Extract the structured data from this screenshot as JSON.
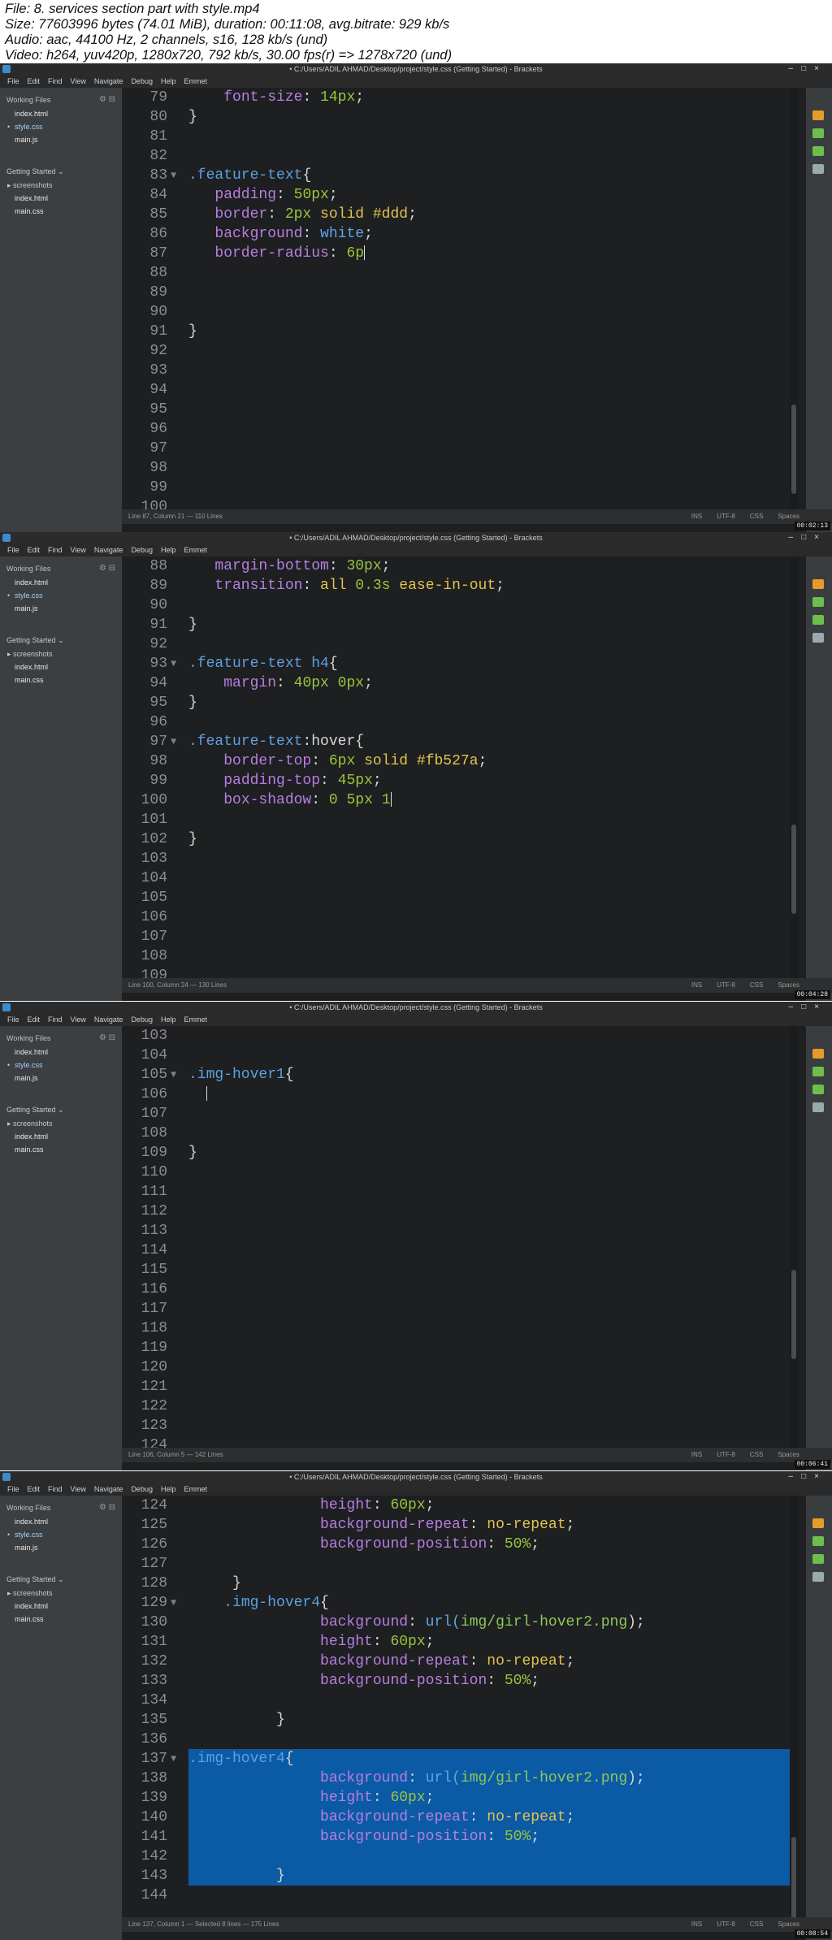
{
  "info": {
    "lines": [
      "File: 8. services section part with style.mp4",
      "Size: 77603996 bytes (74.01 MiB), duration: 00:11:08, avg.bitrate: 929 kb/s",
      "Audio: aac, 44100 Hz, 2 channels, s16, 128 kb/s (und)",
      "Video: h264, yuv420p, 1280x720, 792 kb/s, 30.00 fps(r) => 1278x720 (und)"
    ]
  },
  "app": {
    "title": "• C:/Users/ADIL AHMAD/Desktop/project/style.css (Getting Started) - Brackets",
    "menu": [
      "File",
      "Edit",
      "Find",
      "View",
      "Navigate",
      "Debug",
      "Help",
      "Emmet"
    ],
    "working_files_label": "Working Files",
    "working_files": [
      "index.html",
      "style.css",
      "main.js"
    ],
    "project_label": "Getting Started",
    "project_items": [
      "screenshots",
      "index.html",
      "main.css"
    ],
    "status_encoding": "UTF-8",
    "status_mode": "CSS",
    "status_ins": "INS",
    "status_spaces": "Spaces"
  },
  "frames": [
    {
      "status": "Line 87, Column 21 — 110 Lines",
      "timestamp": "00:02:13",
      "lines": [
        {
          "n": "79",
          "segs": [
            [
              "    ",
              "pl"
            ],
            [
              "font-size",
              "prop"
            ],
            [
              ": ",
              "pl"
            ],
            [
              "14px",
              "num"
            ],
            [
              ";",
              "pl"
            ]
          ]
        },
        {
          "n": "80",
          "segs": [
            [
              "}",
              "pl"
            ]
          ]
        },
        {
          "n": "81",
          "segs": []
        },
        {
          "n": "82",
          "segs": []
        },
        {
          "n": "83",
          "fold": true,
          "segs": [
            [
              ".feature-text",
              "sel"
            ],
            [
              "{",
              "pl"
            ]
          ]
        },
        {
          "n": "84",
          "segs": [
            [
              "   ",
              "pl"
            ],
            [
              "padding",
              "prop"
            ],
            [
              ": ",
              "pl"
            ],
            [
              "50px",
              "num"
            ],
            [
              ";",
              "pl"
            ]
          ]
        },
        {
          "n": "85",
          "segs": [
            [
              "   ",
              "pl"
            ],
            [
              "border",
              "prop"
            ],
            [
              ": ",
              "pl"
            ],
            [
              "2px",
              "num"
            ],
            [
              " ",
              "pl"
            ],
            [
              "solid",
              "val"
            ],
            [
              " ",
              "pl"
            ],
            [
              "#ddd",
              "val"
            ],
            [
              ";",
              "pl"
            ]
          ]
        },
        {
          "n": "86",
          "segs": [
            [
              "   ",
              "pl"
            ],
            [
              "background",
              "prop"
            ],
            [
              ": ",
              "pl"
            ],
            [
              "white",
              "kw"
            ],
            [
              ";",
              "pl"
            ]
          ]
        },
        {
          "n": "87",
          "segs": [
            [
              "   ",
              "pl"
            ],
            [
              "border-radius",
              "prop"
            ],
            [
              ": ",
              "pl"
            ],
            [
              "6p",
              "num"
            ]
          ],
          "cursor": true
        },
        {
          "n": "88",
          "segs": []
        },
        {
          "n": "89",
          "segs": []
        },
        {
          "n": "90",
          "segs": []
        },
        {
          "n": "91",
          "segs": [
            [
              "}",
              "pl"
            ]
          ]
        },
        {
          "n": "92",
          "segs": []
        },
        {
          "n": "93",
          "segs": []
        },
        {
          "n": "94",
          "segs": []
        },
        {
          "n": "95",
          "segs": []
        },
        {
          "n": "96",
          "segs": []
        },
        {
          "n": "97",
          "segs": []
        },
        {
          "n": "98",
          "segs": []
        },
        {
          "n": "99",
          "segs": []
        },
        {
          "n": "100",
          "segs": []
        }
      ]
    },
    {
      "status": "Line 100, Column 24 — 130 Lines",
      "timestamp": "00:04:28",
      "lines": [
        {
          "n": "88",
          "segs": [
            [
              "   ",
              "pl"
            ],
            [
              "margin-bottom",
              "prop"
            ],
            [
              ": ",
              "pl"
            ],
            [
              "30px",
              "num"
            ],
            [
              ";",
              "pl"
            ]
          ]
        },
        {
          "n": "89",
          "segs": [
            [
              "   ",
              "pl"
            ],
            [
              "transition",
              "prop"
            ],
            [
              ": ",
              "pl"
            ],
            [
              "all",
              "val"
            ],
            [
              " ",
              "pl"
            ],
            [
              "0.3s",
              "num"
            ],
            [
              " ",
              "pl"
            ],
            [
              "ease-in-out",
              "val"
            ],
            [
              ";",
              "pl"
            ]
          ]
        },
        {
          "n": "90",
          "segs": []
        },
        {
          "n": "91",
          "segs": [
            [
              "}",
              "pl"
            ]
          ]
        },
        {
          "n": "92",
          "segs": []
        },
        {
          "n": "93",
          "fold": true,
          "segs": [
            [
              ".feature-text h4",
              "sel"
            ],
            [
              "{",
              "pl"
            ]
          ]
        },
        {
          "n": "94",
          "segs": [
            [
              "    ",
              "pl"
            ],
            [
              "margin",
              "prop"
            ],
            [
              ": ",
              "pl"
            ],
            [
              "40px",
              "num"
            ],
            [
              " ",
              "pl"
            ],
            [
              "0px",
              "num"
            ],
            [
              ";",
              "pl"
            ]
          ]
        },
        {
          "n": "95",
          "segs": [
            [
              "}",
              "pl"
            ]
          ]
        },
        {
          "n": "96",
          "segs": []
        },
        {
          "n": "97",
          "fold": true,
          "segs": [
            [
              ".feature-text",
              "sel"
            ],
            [
              ":hover{",
              "pl"
            ]
          ]
        },
        {
          "n": "98",
          "segs": [
            [
              "    ",
              "pl"
            ],
            [
              "border-top",
              "prop"
            ],
            [
              ": ",
              "pl"
            ],
            [
              "6px",
              "num"
            ],
            [
              " ",
              "pl"
            ],
            [
              "solid",
              "val"
            ],
            [
              " ",
              "pl"
            ],
            [
              "#fb527a",
              "val"
            ],
            [
              ";",
              "pl"
            ]
          ]
        },
        {
          "n": "99",
          "segs": [
            [
              "    ",
              "pl"
            ],
            [
              "padding-top",
              "prop"
            ],
            [
              ": ",
              "pl"
            ],
            [
              "45px",
              "num"
            ],
            [
              ";",
              "pl"
            ]
          ]
        },
        {
          "n": "100",
          "segs": [
            [
              "    ",
              "pl"
            ],
            [
              "box-shadow",
              "prop"
            ],
            [
              ": ",
              "pl"
            ],
            [
              "0",
              "num"
            ],
            [
              " ",
              "pl"
            ],
            [
              "5px",
              "num"
            ],
            [
              " ",
              "pl"
            ],
            [
              "1",
              "num"
            ]
          ],
          "cursor": true
        },
        {
          "n": "101",
          "segs": []
        },
        {
          "n": "102",
          "segs": [
            [
              "}",
              "pl"
            ]
          ]
        },
        {
          "n": "103",
          "segs": []
        },
        {
          "n": "104",
          "segs": []
        },
        {
          "n": "105",
          "segs": []
        },
        {
          "n": "106",
          "segs": []
        },
        {
          "n": "107",
          "segs": []
        },
        {
          "n": "108",
          "segs": []
        },
        {
          "n": "109",
          "segs": []
        }
      ]
    },
    {
      "status": "Line 106, Column 5 — 142 Lines",
      "timestamp": "00:06:41",
      "lines": [
        {
          "n": "103",
          "segs": []
        },
        {
          "n": "104",
          "segs": []
        },
        {
          "n": "105",
          "fold": true,
          "segs": [
            [
              ".img-hover1",
              "sel"
            ],
            [
              "{",
              "pl"
            ]
          ]
        },
        {
          "n": "106",
          "segs": [
            [
              "  ",
              "pl"
            ]
          ],
          "cursor": true
        },
        {
          "n": "107",
          "segs": []
        },
        {
          "n": "108",
          "segs": []
        },
        {
          "n": "109",
          "segs": [
            [
              "}",
              "pl"
            ]
          ]
        },
        {
          "n": "110",
          "segs": []
        },
        {
          "n": "111",
          "segs": []
        },
        {
          "n": "112",
          "segs": []
        },
        {
          "n": "113",
          "segs": []
        },
        {
          "n": "114",
          "segs": []
        },
        {
          "n": "115",
          "segs": []
        },
        {
          "n": "116",
          "segs": []
        },
        {
          "n": "117",
          "segs": []
        },
        {
          "n": "118",
          "segs": []
        },
        {
          "n": "119",
          "segs": []
        },
        {
          "n": "120",
          "segs": []
        },
        {
          "n": "121",
          "segs": []
        },
        {
          "n": "122",
          "segs": []
        },
        {
          "n": "123",
          "segs": []
        },
        {
          "n": "124",
          "segs": []
        }
      ]
    },
    {
      "status": "Line 137, Column 1 — Selected 8 lines — 175 Lines",
      "timestamp": "00:08:54",
      "lines": [
        {
          "n": "124",
          "segs": [
            [
              "               ",
              "pl"
            ],
            [
              "height",
              "prop"
            ],
            [
              ": ",
              "pl"
            ],
            [
              "60px",
              "num"
            ],
            [
              ";",
              "pl"
            ]
          ]
        },
        {
          "n": "125",
          "segs": [
            [
              "               ",
              "pl"
            ],
            [
              "background-repeat",
              "prop"
            ],
            [
              ": ",
              "pl"
            ],
            [
              "no-repeat",
              "val"
            ],
            [
              ";",
              "pl"
            ]
          ]
        },
        {
          "n": "126",
          "segs": [
            [
              "               ",
              "pl"
            ],
            [
              "background-position",
              "prop"
            ],
            [
              ": ",
              "pl"
            ],
            [
              "50%",
              "num"
            ],
            [
              ";",
              "pl"
            ]
          ]
        },
        {
          "n": "127",
          "segs": []
        },
        {
          "n": "128",
          "segs": [
            [
              "     }",
              "pl"
            ]
          ]
        },
        {
          "n": "129",
          "fold": true,
          "segs": [
            [
              "    ",
              "pl"
            ],
            [
              ".img-hover4",
              "sel"
            ],
            [
              "{",
              "pl"
            ]
          ]
        },
        {
          "n": "130",
          "segs": [
            [
              "               ",
              "pl"
            ],
            [
              "background",
              "prop"
            ],
            [
              ": ",
              "pl"
            ],
            [
              "url(",
              "fn"
            ],
            [
              "img/girl-hover2.png",
              "str"
            ],
            [
              ");",
              "pl"
            ]
          ]
        },
        {
          "n": "131",
          "segs": [
            [
              "               ",
              "pl"
            ],
            [
              "height",
              "prop"
            ],
            [
              ": ",
              "pl"
            ],
            [
              "60px",
              "num"
            ],
            [
              ";",
              "pl"
            ]
          ]
        },
        {
          "n": "132",
          "segs": [
            [
              "               ",
              "pl"
            ],
            [
              "background-repeat",
              "prop"
            ],
            [
              ": ",
              "pl"
            ],
            [
              "no-repeat",
              "val"
            ],
            [
              ";",
              "pl"
            ]
          ]
        },
        {
          "n": "133",
          "segs": [
            [
              "               ",
              "pl"
            ],
            [
              "background-position",
              "prop"
            ],
            [
              ": ",
              "pl"
            ],
            [
              "50%",
              "num"
            ],
            [
              ";",
              "pl"
            ]
          ]
        },
        {
          "n": "134",
          "segs": []
        },
        {
          "n": "135",
          "segs": [
            [
              "          }",
              "pl"
            ]
          ]
        },
        {
          "n": "136",
          "segs": []
        },
        {
          "n": "137",
          "fold": true,
          "sel": true,
          "segs": [
            [
              ".img-hover4",
              "sel"
            ],
            [
              "{",
              "pl"
            ]
          ]
        },
        {
          "n": "138",
          "sel": true,
          "segs": [
            [
              "               ",
              "pl"
            ],
            [
              "background",
              "prop"
            ],
            [
              ": ",
              "pl"
            ],
            [
              "url(",
              "fn"
            ],
            [
              "img/girl-hover2.png",
              "str"
            ],
            [
              ");",
              "pl"
            ]
          ]
        },
        {
          "n": "139",
          "sel": true,
          "segs": [
            [
              "               ",
              "pl"
            ],
            [
              "height",
              "prop"
            ],
            [
              ": ",
              "pl"
            ],
            [
              "60px",
              "num"
            ],
            [
              ";",
              "pl"
            ]
          ]
        },
        {
          "n": "140",
          "sel": true,
          "segs": [
            [
              "               ",
              "pl"
            ],
            [
              "background-repeat",
              "prop"
            ],
            [
              ": ",
              "pl"
            ],
            [
              "no-repeat",
              "val"
            ],
            [
              ";",
              "pl"
            ]
          ]
        },
        {
          "n": "141",
          "sel": true,
          "segs": [
            [
              "               ",
              "pl"
            ],
            [
              "background-position",
              "prop"
            ],
            [
              ": ",
              "pl"
            ],
            [
              "50%",
              "num"
            ],
            [
              ";",
              "pl"
            ]
          ]
        },
        {
          "n": "142",
          "sel": true,
          "segs": []
        },
        {
          "n": "143",
          "sel": true,
          "segs": [
            [
              "          }",
              "pl"
            ]
          ]
        },
        {
          "n": "144",
          "segs": []
        }
      ]
    }
  ],
  "colors": {
    "editor_bg": "#1d1f21",
    "selection": "#0b5aa6",
    "property": "#b87ee0",
    "number": "#9bc53d",
    "selector": "#5ea0e0"
  }
}
